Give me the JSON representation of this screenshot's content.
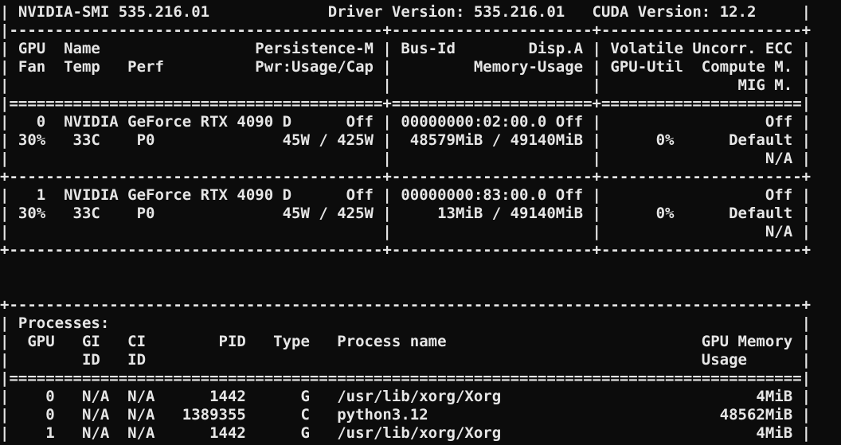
{
  "terminal": {
    "lines": [
      "| NVIDIA-SMI 535.216.01             Driver Version: 535.216.01   CUDA Version: 12.2     |",
      "|-----------------------------------------+----------------------+----------------------+",
      "| GPU  Name                 Persistence-M | Bus-Id        Disp.A | Volatile Uncorr. ECC |",
      "| Fan  Temp   Perf          Pwr:Usage/Cap |         Memory-Usage | GPU-Util  Compute M. |",
      "|                                         |                      |               MIG M. |",
      "|=========================================+======================+======================|",
      "|   0  NVIDIA GeForce RTX 4090 D      Off | 00000000:02:00.0 Off |                  Off |",
      "| 30%   33C    P0              45W / 425W |  48579MiB / 49140MiB |      0%      Default |",
      "|                                         |                      |                  N/A |",
      "+-----------------------------------------+----------------------+----------------------+",
      "|   1  NVIDIA GeForce RTX 4090 D      Off | 00000000:83:00.0 Off |                  Off |",
      "| 30%   33C    P0              45W / 425W |     13MiB / 49140MiB |      0%      Default |",
      "|                                         |                      |                  N/A |",
      "+-----------------------------------------+----------------------+----------------------+",
      "",
      "",
      "+---------------------------------------------------------------------------------------+",
      "| Processes:                                                                            |",
      "|  GPU   GI   CI        PID   Type   Process name                            GPU Memory |",
      "|        ID   ID                                                             Usage      |",
      "|=======================================================================================|",
      "|    0   N/A  N/A      1442      G   /usr/lib/xorg/Xorg                            4MiB |",
      "|    0   N/A  N/A   1389355      C   python3.12                                48562MiB |",
      "|    1   N/A  N/A      1442      G   /usr/lib/xorg/Xorg                            4MiB |",
      "+---------------------------------------------------------------------------------------+"
    ]
  },
  "colors": {
    "background": "#0c0c0c",
    "foreground": "#e6e6e6"
  }
}
